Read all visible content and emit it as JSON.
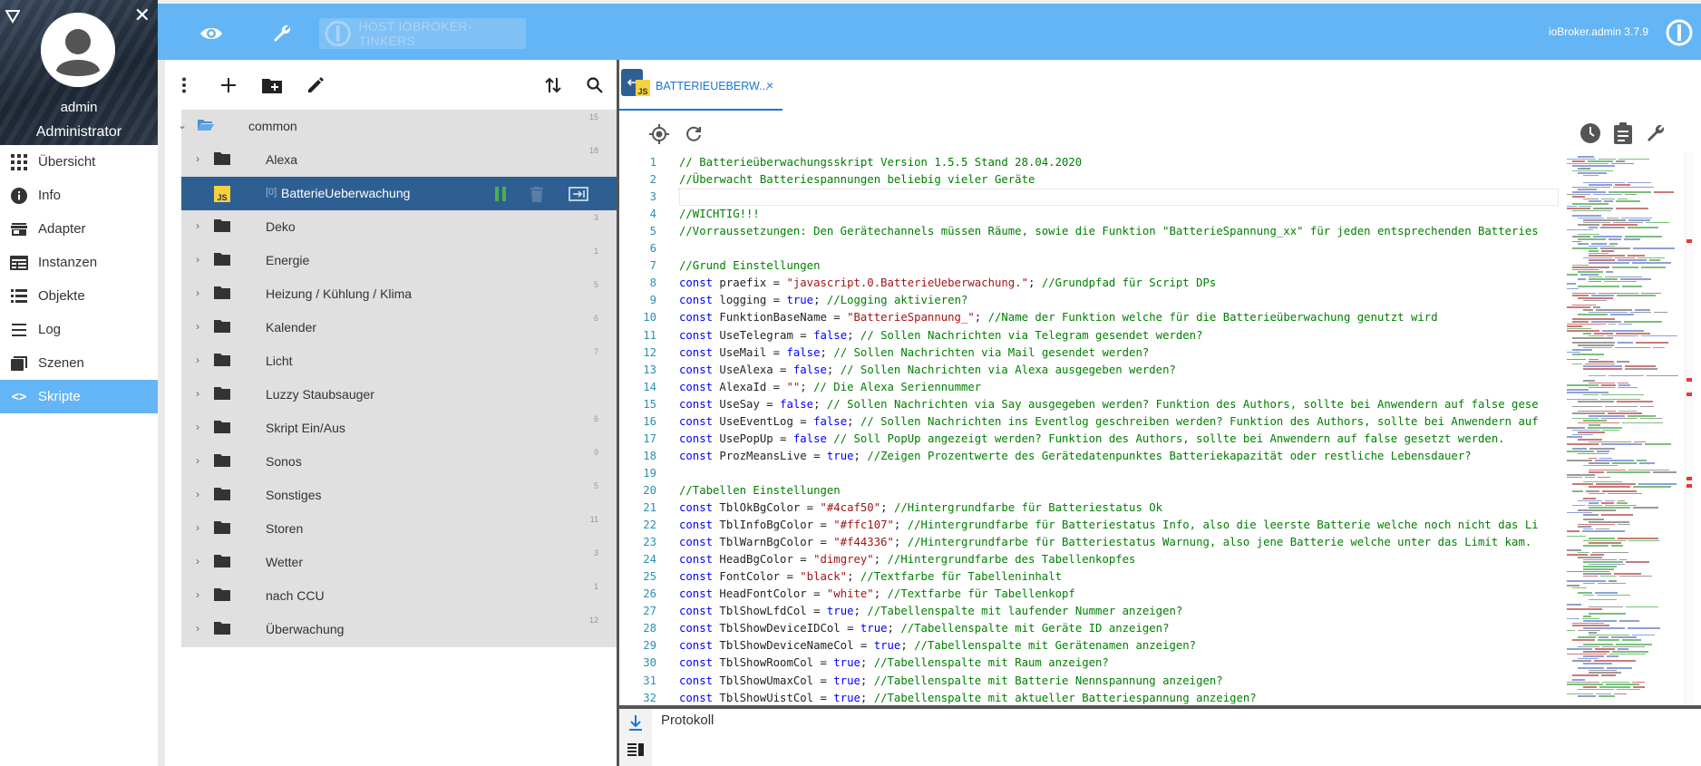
{
  "sidebar": {
    "user_name": "admin",
    "user_role": "Administrator",
    "items": [
      {
        "label": "Übersicht",
        "icon": "grid-icon"
      },
      {
        "label": "Info",
        "icon": "info-icon"
      },
      {
        "label": "Adapter",
        "icon": "store-icon"
      },
      {
        "label": "Instanzen",
        "icon": "instances-icon"
      },
      {
        "label": "Objekte",
        "icon": "list-icon"
      },
      {
        "label": "Log",
        "icon": "lines-icon"
      },
      {
        "label": "Szenen",
        "icon": "scenes-icon"
      },
      {
        "label": "Skripte",
        "icon": "code-icon",
        "active": true
      }
    ]
  },
  "topbar": {
    "host": "HOST IOBROKER-TINKERS",
    "version": "ioBroker.admin 3.7.9"
  },
  "tree": {
    "root": {
      "label": "common",
      "count": "15"
    },
    "rows": [
      {
        "label": "Alexa",
        "count": "18",
        "type": "folder"
      },
      {
        "label": "BatterieUeberwachung",
        "prefix": "[0]",
        "count": "",
        "type": "script",
        "selected": true
      },
      {
        "label": "Deko",
        "count": "3",
        "type": "folder"
      },
      {
        "label": "Energie",
        "count": "1",
        "type": "folder"
      },
      {
        "label": "Heizung / Kühlung / Klima",
        "count": "5",
        "type": "folder"
      },
      {
        "label": "Kalender",
        "count": "6",
        "type": "folder"
      },
      {
        "label": "Licht",
        "count": "7",
        "type": "folder"
      },
      {
        "label": "Luzzy Staubsauger",
        "count": "",
        "type": "folder"
      },
      {
        "label": "Skript Ein/Aus",
        "count": "6",
        "type": "folder"
      },
      {
        "label": "Sonos",
        "count": "9",
        "type": "folder"
      },
      {
        "label": "Sonstiges",
        "count": "5",
        "type": "folder"
      },
      {
        "label": "Storen",
        "count": "11",
        "type": "folder"
      },
      {
        "label": "Wetter",
        "count": "3",
        "type": "folder"
      },
      {
        "label": "nach CCU",
        "count": "1",
        "type": "folder"
      },
      {
        "label": "Überwachung",
        "count": "12",
        "type": "folder"
      }
    ]
  },
  "editor": {
    "tab_label": "BATTERIEUEBERW...",
    "tab_badge": "JS",
    "log_title": "Protokoll",
    "lines": [
      {
        "n": "1",
        "parts": [
          [
            "cm",
            "// Batterieüberwachungsskript Version 1.5.5 Stand 28.04.2020"
          ]
        ]
      },
      {
        "n": "2",
        "parts": [
          [
            "cm",
            "//Überwacht Batteriespannungen beliebig vieler Geräte"
          ]
        ]
      },
      {
        "n": "3",
        "parts": []
      },
      {
        "n": "4",
        "parts": [
          [
            "cm",
            "//WICHTIG!!!"
          ]
        ]
      },
      {
        "n": "5",
        "parts": [
          [
            "cm",
            "//Vorraussetzungen: Den Gerätechannels müssen Räume, sowie die Funktion \"BatterieSpannung_xx\" für jeden entsprechenden Batteries"
          ]
        ]
      },
      {
        "n": "6",
        "parts": []
      },
      {
        "n": "7",
        "parts": [
          [
            "cm",
            "//Grund Einstellungen"
          ]
        ]
      },
      {
        "n": "8",
        "parts": [
          [
            "kw",
            "const "
          ],
          [
            "tx",
            "praefix = "
          ],
          [
            "st",
            "\"javascript.0.BatterieUeberwachung.\""
          ],
          [
            "tx",
            "; "
          ],
          [
            "cm",
            "//Grundpfad für Script DPs"
          ]
        ]
      },
      {
        "n": "9",
        "parts": [
          [
            "kw",
            "const "
          ],
          [
            "tx",
            "logging = "
          ],
          [
            "kw",
            "true"
          ],
          [
            "tx",
            "; "
          ],
          [
            "cm",
            "//Logging aktivieren?"
          ]
        ]
      },
      {
        "n": "10",
        "parts": [
          [
            "kw",
            "const "
          ],
          [
            "tx",
            "FunktionBaseName = "
          ],
          [
            "st",
            "\"BatterieSpannung_\""
          ],
          [
            "tx",
            "; "
          ],
          [
            "cm",
            "//Name der Funktion welche für die Batterieüberwachung genutzt wird"
          ]
        ]
      },
      {
        "n": "11",
        "parts": [
          [
            "kw",
            "const "
          ],
          [
            "tx",
            "UseTelegram = "
          ],
          [
            "kw",
            "false"
          ],
          [
            "tx",
            "; "
          ],
          [
            "cm",
            "// Sollen Nachrichten via Telegram gesendet werden?"
          ]
        ]
      },
      {
        "n": "12",
        "parts": [
          [
            "kw",
            "const "
          ],
          [
            "tx",
            "UseMail = "
          ],
          [
            "kw",
            "false"
          ],
          [
            "tx",
            "; "
          ],
          [
            "cm",
            "// Sollen Nachrichten via Mail gesendet werden?"
          ]
        ]
      },
      {
        "n": "13",
        "parts": [
          [
            "kw",
            "const "
          ],
          [
            "tx",
            "UseAlexa = "
          ],
          [
            "kw",
            "false"
          ],
          [
            "tx",
            "; "
          ],
          [
            "cm",
            "// Sollen Nachrichten via Alexa ausgegeben werden?"
          ]
        ]
      },
      {
        "n": "14",
        "parts": [
          [
            "kw",
            "const "
          ],
          [
            "tx",
            "AlexaId = "
          ],
          [
            "st",
            "\"\""
          ],
          [
            "tx",
            "; "
          ],
          [
            "cm",
            "// Die Alexa Seriennummer"
          ]
        ]
      },
      {
        "n": "15",
        "parts": [
          [
            "kw",
            "const "
          ],
          [
            "tx",
            "UseSay = "
          ],
          [
            "kw",
            "false"
          ],
          [
            "tx",
            "; "
          ],
          [
            "cm",
            "// Sollen Nachrichten via Say ausgegeben werden? Funktion des Authors, sollte bei Anwendern auf false gese"
          ]
        ]
      },
      {
        "n": "16",
        "parts": [
          [
            "kw",
            "const "
          ],
          [
            "tx",
            "UseEventLog = "
          ],
          [
            "kw",
            "false"
          ],
          [
            "tx",
            "; "
          ],
          [
            "cm",
            "// Sollen Nachrichten ins Eventlog geschreiben werden? Funktion des Authors, sollte bei Anwendern auf"
          ]
        ]
      },
      {
        "n": "17",
        "parts": [
          [
            "kw",
            "const "
          ],
          [
            "tx",
            "UsePopUp = "
          ],
          [
            "kw",
            "false"
          ],
          [
            "tx",
            " "
          ],
          [
            "cm",
            "// Soll PopUp angezeigt werden? Funktion des Authors, sollte bei Anwendern auf false gesetzt werden."
          ]
        ]
      },
      {
        "n": "18",
        "parts": [
          [
            "kw",
            "const "
          ],
          [
            "tx",
            "ProzMeansLive = "
          ],
          [
            "kw",
            "true"
          ],
          [
            "tx",
            "; "
          ],
          [
            "cm",
            "//Zeigen Prozentwerte des Gerätedatenpunktes Batteriekapazität oder restliche Lebensdauer?"
          ]
        ]
      },
      {
        "n": "19",
        "parts": []
      },
      {
        "n": "20",
        "parts": [
          [
            "cm",
            "//Tabellen Einstellungen"
          ]
        ]
      },
      {
        "n": "21",
        "parts": [
          [
            "kw",
            "const "
          ],
          [
            "tx",
            "TblOkBgColor = "
          ],
          [
            "st",
            "\"#4caf50\""
          ],
          [
            "tx",
            "; "
          ],
          [
            "cm",
            "//Hintergrundfarbe für Batteriestatus Ok"
          ]
        ]
      },
      {
        "n": "22",
        "parts": [
          [
            "kw",
            "const "
          ],
          [
            "tx",
            "TblInfoBgColor = "
          ],
          [
            "st",
            "\"#ffc107\""
          ],
          [
            "tx",
            "; "
          ],
          [
            "cm",
            "//Hintergrundfarbe für Batteriestatus Info, also die leerste Batterie welche noch nicht das Li"
          ]
        ]
      },
      {
        "n": "23",
        "parts": [
          [
            "kw",
            "const "
          ],
          [
            "tx",
            "TblWarnBgColor = "
          ],
          [
            "st",
            "\"#f44336\""
          ],
          [
            "tx",
            "; "
          ],
          [
            "cm",
            "//Hintergrundfarbe für Batteriestatus Warnung, also jene Batterie welche unter das Limit kam."
          ]
        ]
      },
      {
        "n": "24",
        "parts": [
          [
            "kw",
            "const "
          ],
          [
            "tx",
            "HeadBgColor = "
          ],
          [
            "st",
            "\"dimgrey\""
          ],
          [
            "tx",
            "; "
          ],
          [
            "cm",
            "//Hintergrundfarbe des Tabellenkopfes"
          ]
        ]
      },
      {
        "n": "25",
        "parts": [
          [
            "kw",
            "const "
          ],
          [
            "tx",
            "FontColor = "
          ],
          [
            "st",
            "\"black\""
          ],
          [
            "tx",
            "; "
          ],
          [
            "cm",
            "//Textfarbe für Tabelleninhalt"
          ]
        ]
      },
      {
        "n": "26",
        "parts": [
          [
            "kw",
            "const "
          ],
          [
            "tx",
            "HeadFontColor = "
          ],
          [
            "st",
            "\"white\""
          ],
          [
            "tx",
            "; "
          ],
          [
            "cm",
            "//Textfarbe für Tabellenkopf"
          ]
        ]
      },
      {
        "n": "27",
        "parts": [
          [
            "kw",
            "const "
          ],
          [
            "tx",
            "TblShowLfdCol = "
          ],
          [
            "kw",
            "true"
          ],
          [
            "tx",
            "; "
          ],
          [
            "cm",
            "//Tabellenspalte mit laufender Nummer anzeigen?"
          ]
        ]
      },
      {
        "n": "28",
        "parts": [
          [
            "kw",
            "const "
          ],
          [
            "tx",
            "TblShowDeviceIDCol = "
          ],
          [
            "kw",
            "true"
          ],
          [
            "tx",
            "; "
          ],
          [
            "cm",
            "//Tabellenspalte mit Geräte ID anzeigen?"
          ]
        ]
      },
      {
        "n": "29",
        "parts": [
          [
            "kw",
            "const "
          ],
          [
            "tx",
            "TblShowDeviceNameCol = "
          ],
          [
            "kw",
            "true"
          ],
          [
            "tx",
            "; "
          ],
          [
            "cm",
            "//Tabellenspalte mit Gerätenamen anzeigen?"
          ]
        ]
      },
      {
        "n": "30",
        "parts": [
          [
            "kw",
            "const "
          ],
          [
            "tx",
            "TblShowRoomCol = "
          ],
          [
            "kw",
            "true"
          ],
          [
            "tx",
            "; "
          ],
          [
            "cm",
            "//Tabellenspalte mit Raum anzeigen?"
          ]
        ]
      },
      {
        "n": "31",
        "parts": [
          [
            "kw",
            "const "
          ],
          [
            "tx",
            "TblShowUmaxCol = "
          ],
          [
            "kw",
            "true"
          ],
          [
            "tx",
            "; "
          ],
          [
            "cm",
            "//Tabellenspalte mit Batterie Nennspannung anzeigen?"
          ]
        ]
      },
      {
        "n": "32",
        "parts": [
          [
            "kw",
            "const "
          ],
          [
            "tx",
            "TblShowUistCol = "
          ],
          [
            "kw",
            "true"
          ],
          [
            "tx",
            "; "
          ],
          [
            "cm",
            "//Tabellenspalte mit aktueller Batteriespannung anzeigen?"
          ]
        ]
      }
    ]
  },
  "colors": {
    "accent": "#64b5f6",
    "selected_row": "#2e5f92",
    "pause_green": "#4caf50",
    "js_badge": "#f7d23e"
  }
}
